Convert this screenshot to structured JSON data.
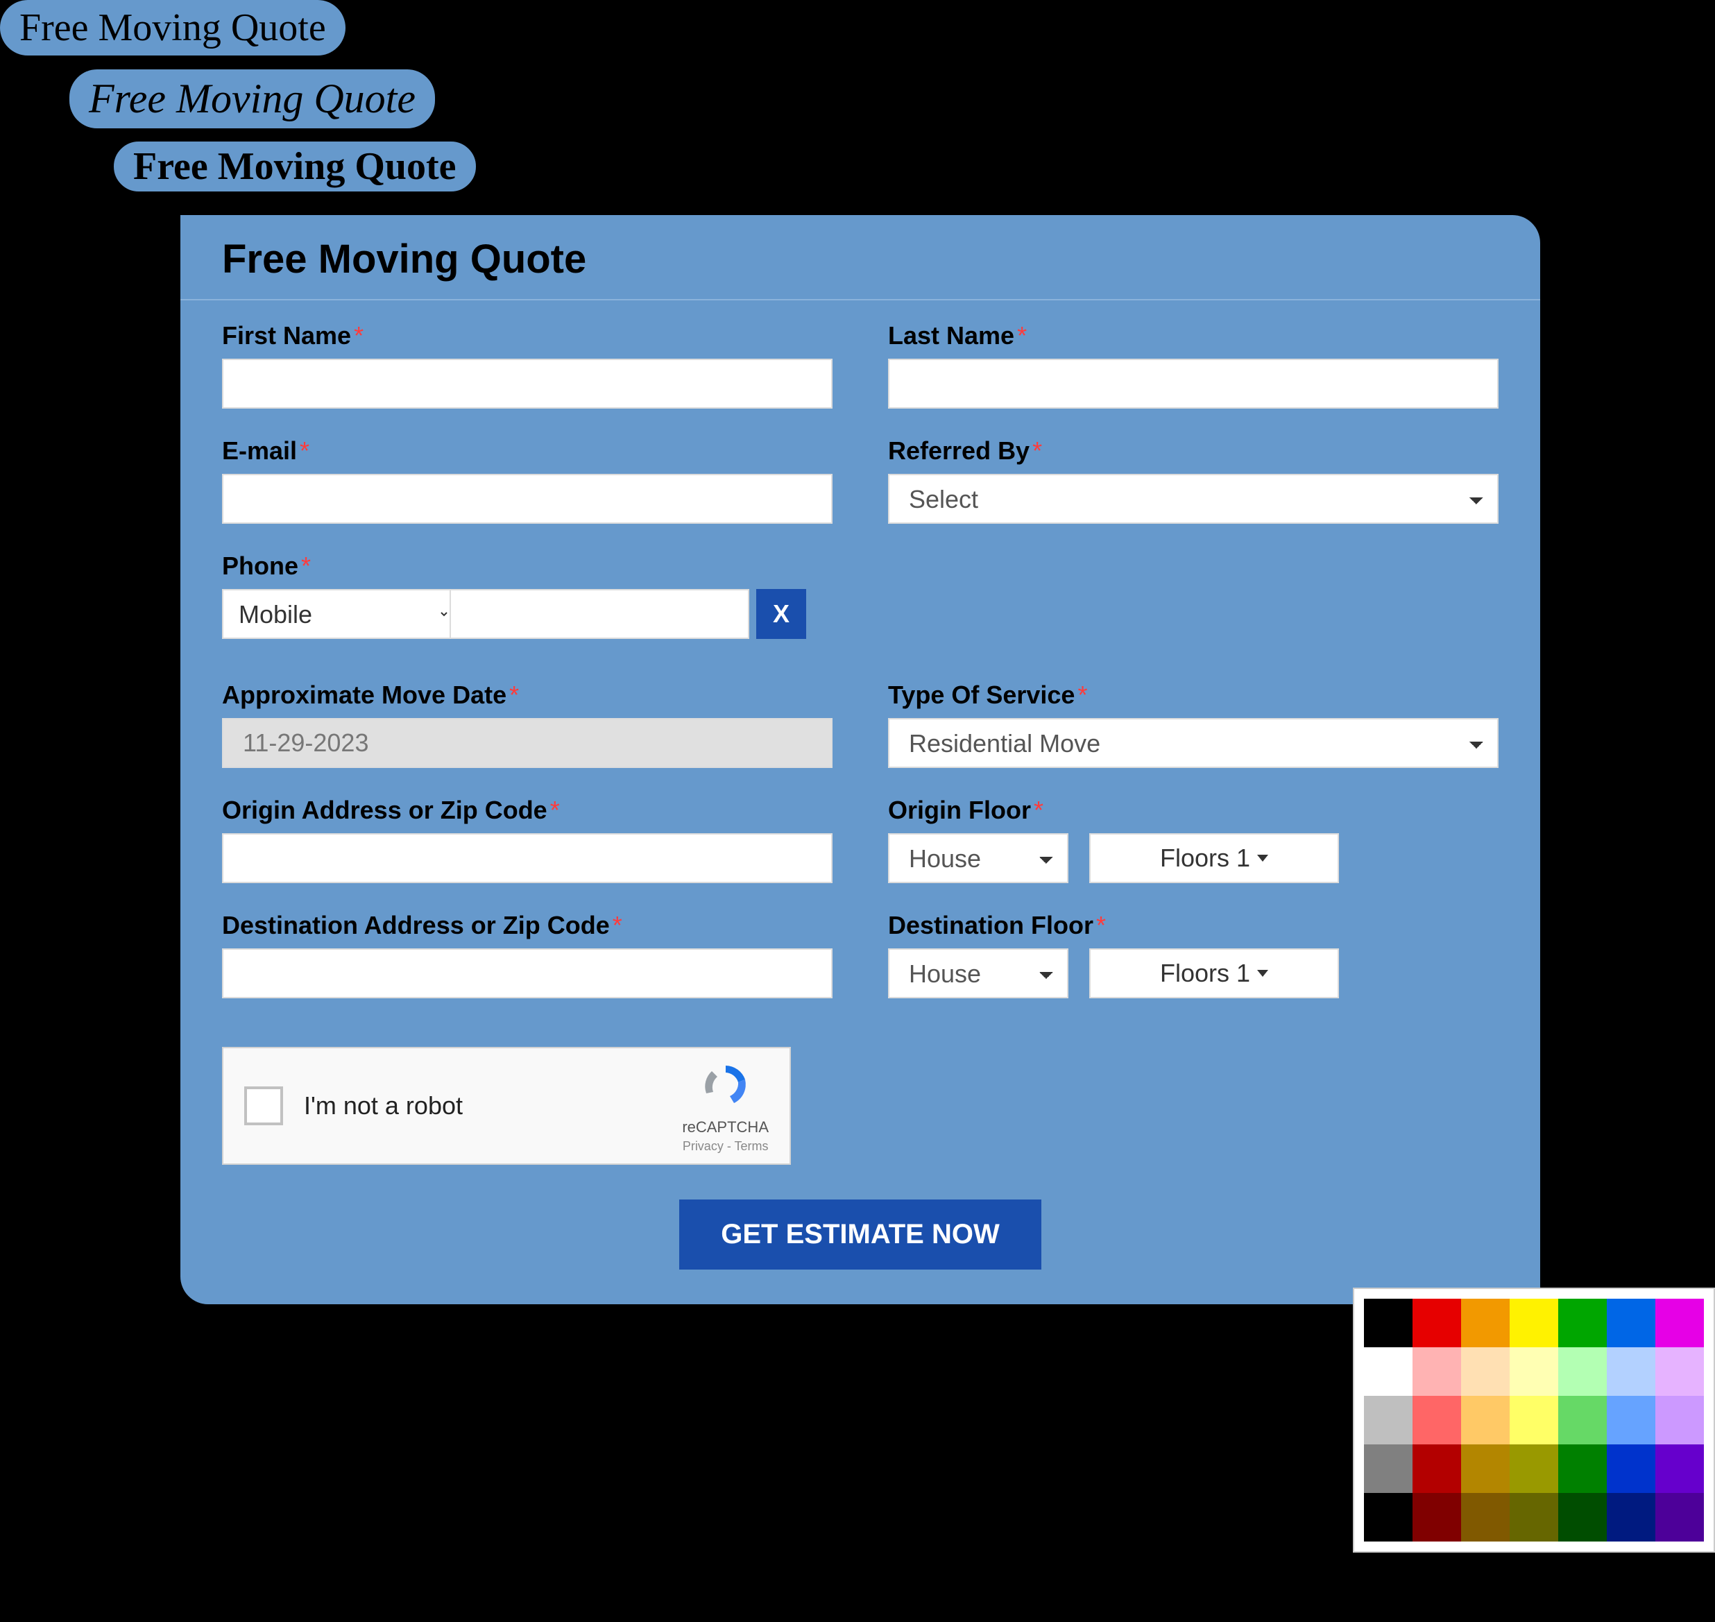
{
  "pills": {
    "p1": "Free Moving Quote",
    "p2": "Free Moving Quote",
    "p3": "Free Moving Quote"
  },
  "form": {
    "title": "Free Moving Quote",
    "first_name_label": "First Name",
    "last_name_label": "Last Name",
    "email_label": "E-mail",
    "referred_by_label": "Referred By",
    "referred_by_value": "Select",
    "phone_label": "Phone",
    "phone_type_value": "Mobile",
    "phone_number_value": "",
    "phone_x": "X",
    "move_date_label": "Approximate Move Date",
    "move_date_value": "11-29-2023",
    "service_type_label": "Type Of Service",
    "service_type_value": "Residential Move",
    "origin_addr_label": "Origin Address or Zip Code",
    "origin_floor_label": "Origin Floor",
    "origin_floor_type": "House",
    "origin_floor_num": "Floors 1",
    "dest_addr_label": "Destination Address or Zip Code",
    "dest_floor_label": "Destination Floor",
    "dest_floor_type": "House",
    "dest_floor_num": "Floors 1",
    "submit_label": "GET ESTIMATE NOW"
  },
  "recaptcha": {
    "text": "I'm not a robot",
    "brand": "reCAPTCHA",
    "links": "Privacy - Terms"
  },
  "palette": [
    "#000000",
    "#e60000",
    "#f29900",
    "#fff200",
    "#00a600",
    "#0066e6",
    "#e600e6",
    "#ffffff",
    "#ffb3b3",
    "#ffe0b3",
    "#ffffb3",
    "#b3ffb3",
    "#b3d1ff",
    "#e6b3ff",
    "#bfbfbf",
    "#ff6666",
    "#ffc966",
    "#ffff66",
    "#66d966",
    "#66a3ff",
    "#cc99ff",
    "#808080",
    "#b30000",
    "#b38600",
    "#999900",
    "#008000",
    "#0033cc",
    "#6600cc",
    "#000000",
    "#800000",
    "#805900",
    "#666600",
    "#004d00",
    "#001a80",
    "#4d0099"
  ],
  "colors": {
    "panel": "#6699cc",
    "primary_button": "#1a4fad",
    "required": "#ff3b3b"
  }
}
